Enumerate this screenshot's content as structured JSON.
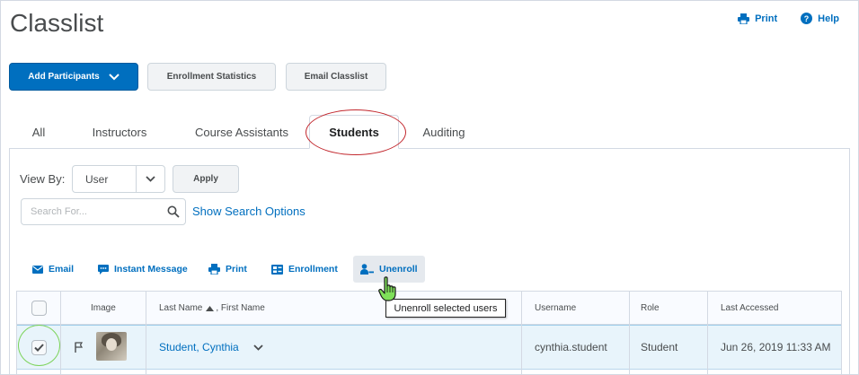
{
  "page": {
    "title": "Classlist"
  },
  "top_actions": {
    "print": {
      "label": "Print",
      "icon": "printer-icon"
    },
    "help": {
      "label": "Help",
      "icon": "help-circle-icon"
    }
  },
  "buttons": {
    "add_participants": "Add Participants",
    "enrollment_statistics": "Enrollment Statistics",
    "email_classlist": "Email Classlist"
  },
  "tabs": [
    {
      "label": "All",
      "active": false
    },
    {
      "label": "Instructors",
      "active": false
    },
    {
      "label": "Course Assistants",
      "active": false
    },
    {
      "label": "Students",
      "active": true
    },
    {
      "label": "Auditing",
      "active": false
    }
  ],
  "filters": {
    "view_by_label": "View By:",
    "view_by_value": "User",
    "apply_label": "Apply",
    "search_placeholder": "Search For...",
    "show_search_options": "Show Search Options"
  },
  "toolbar": [
    {
      "label": "Email",
      "icon": "envelope-icon"
    },
    {
      "label": "Instant Message",
      "icon": "chat-icon"
    },
    {
      "label": "Print",
      "icon": "printer-icon"
    },
    {
      "label": "Enrollment",
      "icon": "enrollment-card-icon"
    },
    {
      "label": "Unenroll",
      "icon": "user-minus-icon"
    }
  ],
  "tooltip": "Unenroll selected users",
  "table": {
    "headers": {
      "image": "Image",
      "last_name": "Last Name",
      "first_name": ", First Name",
      "username": "Username",
      "role": "Role",
      "last_accessed": "Last Accessed"
    },
    "rows": [
      {
        "name": "Student, Cynthia",
        "username": "cynthia.student",
        "role": "Student",
        "last_accessed": "Jun 26, 2019 11:33 AM",
        "selected": true
      }
    ]
  },
  "colors": {
    "link_blue": "#006fbf",
    "primary_button": "#006fbf",
    "selected_row": "#e8f4fb",
    "annotation_red": "#c2272d",
    "annotation_green": "#7cd35a"
  }
}
